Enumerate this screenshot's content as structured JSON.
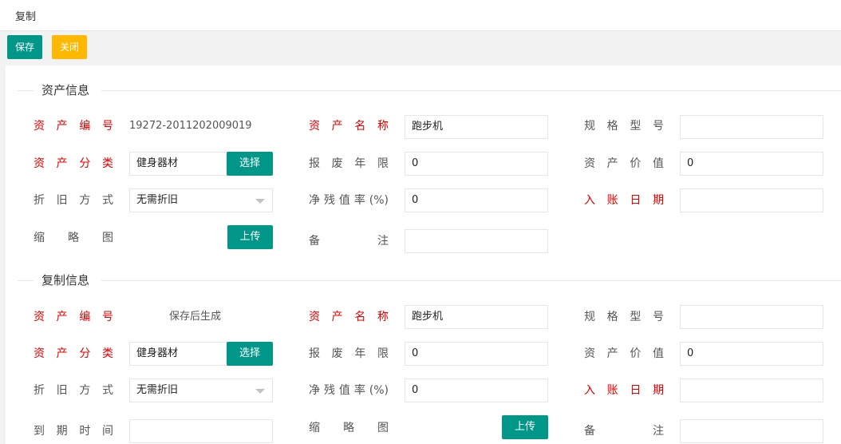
{
  "header": {
    "title": "复制"
  },
  "toolbar": {
    "save_label": "保存",
    "close_label": "关闭"
  },
  "colors": {
    "primary": "#009688",
    "warning": "#ffb800",
    "required": "#e00000"
  },
  "section1": {
    "legend": "资产信息",
    "asset_no_label": "资产编号",
    "asset_no_value": "19272-2011202009019",
    "asset_name_label": "资产名称",
    "asset_name_value": "跑步机",
    "spec_label": "规格型号",
    "spec_value": "",
    "category_label": "资产分类",
    "category_value": "健身器材",
    "category_button": "选择",
    "scrap_years_label": "报废年限",
    "scrap_years_value": "0",
    "asset_value_label": "资产价值",
    "asset_value_value": "0",
    "depreciation_label": "折旧方式",
    "depreciation_value": "无需折旧",
    "residual_rate_label": "净残值率(%)",
    "residual_rate_value": "0",
    "entry_date_label": "入账日期",
    "entry_date_value": "",
    "thumbnail_label": "缩略图",
    "upload_button": "上传",
    "remark_label": "备注",
    "remark_value": ""
  },
  "section2": {
    "legend": "复制信息",
    "asset_no_label": "资产编号",
    "asset_no_value": "保存后生成",
    "asset_name_label": "资产名称",
    "asset_name_value": "跑步机",
    "spec_label": "规格型号",
    "spec_value": "",
    "category_label": "资产分类",
    "category_value": "健身器材",
    "category_button": "选择",
    "scrap_years_label": "报废年限",
    "scrap_years_value": "0",
    "asset_value_label": "资产价值",
    "asset_value_value": "0",
    "depreciation_label": "折旧方式",
    "depreciation_value": "无需折旧",
    "residual_rate_label": "净残值率(%)",
    "residual_rate_value": "0",
    "entry_date_label": "入账日期",
    "entry_date_value": "",
    "expire_label": "到期时间",
    "expire_value": "",
    "thumbnail_label": "缩略图",
    "upload_button": "上传",
    "remark_label": "备注",
    "remark_value": ""
  }
}
